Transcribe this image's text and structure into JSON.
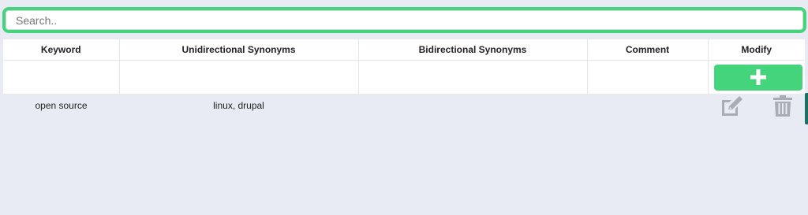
{
  "search": {
    "placeholder": "Search..",
    "value": ""
  },
  "table": {
    "headers": [
      "Keyword",
      "Unidirectional Synonyms",
      "Bidirectional Synonyms",
      "Comment",
      "Modify"
    ],
    "rows": [
      {
        "keyword": "open source",
        "unidirectional": "linux, drupal",
        "bidirectional": "",
        "comment": ""
      }
    ]
  },
  "icons": {
    "add": "plus-icon",
    "edit": "edit-icon",
    "delete": "trash-icon"
  },
  "colors": {
    "accent": "#44d47c",
    "background": "#e8ebf3",
    "icon_gray": "#a9adb3"
  }
}
